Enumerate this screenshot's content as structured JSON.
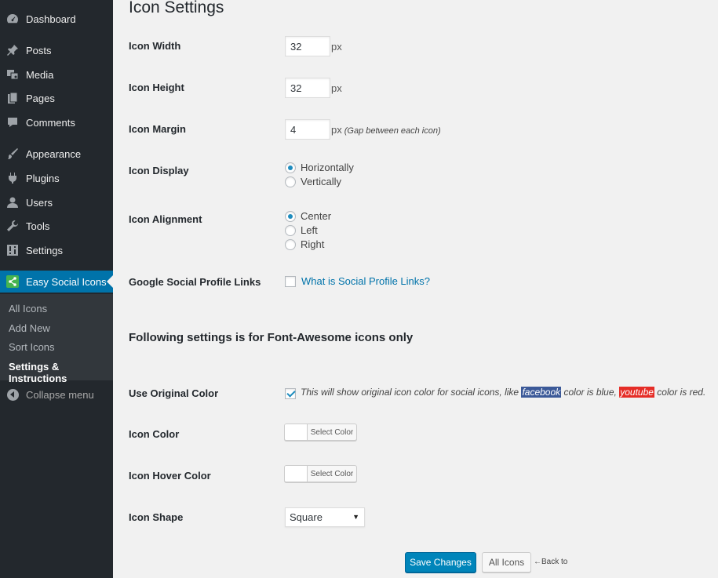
{
  "sidebar": {
    "items": [
      {
        "label": "Dashboard",
        "icon": "dashboard-icon"
      },
      {
        "label": "Posts",
        "icon": "pin-icon"
      },
      {
        "label": "Media",
        "icon": "media-icon"
      },
      {
        "label": "Pages",
        "icon": "pages-icon"
      },
      {
        "label": "Comments",
        "icon": "comment-icon"
      },
      {
        "label": "Appearance",
        "icon": "brush-icon"
      },
      {
        "label": "Plugins",
        "icon": "plug-icon"
      },
      {
        "label": "Users",
        "icon": "user-icon"
      },
      {
        "label": "Tools",
        "icon": "wrench-icon"
      },
      {
        "label": "Settings",
        "icon": "settings-icon"
      },
      {
        "label": "Easy Social Icons",
        "icon": "share-icon",
        "current": true
      }
    ],
    "submenu": [
      "All Icons",
      "Add New",
      "Sort Icons",
      "Settings & Instructions"
    ],
    "submenu_current": "Settings & Instructions",
    "collapse_label": "Collapse menu",
    "colors": {
      "bg": "#23282d",
      "accent": "#0073aa",
      "submenu_bg": "#32373c"
    }
  },
  "main": {
    "title": "Icon Settings",
    "icon_width": {
      "label": "Icon Width",
      "value": "32",
      "unit": "px"
    },
    "icon_height": {
      "label": "Icon Height",
      "value": "32",
      "unit": "px"
    },
    "icon_margin": {
      "label": "Icon Margin",
      "value": "4",
      "unit": "px",
      "hint": "(Gap between each icon)"
    },
    "icon_display": {
      "label": "Icon Display",
      "options": [
        "Horizontally",
        "Vertically"
      ],
      "selected": "Horizontally"
    },
    "icon_alignment": {
      "label": "Icon Alignment",
      "options": [
        "Center",
        "Left",
        "Right"
      ],
      "selected": "Center"
    },
    "google_links": {
      "label": "Google Social Profile Links",
      "checked": false,
      "link_text": "What is Social Profile Links?"
    },
    "fa_heading": "Following settings is for Font-Awesome icons only",
    "use_original_color": {
      "label": "Use Original Color",
      "checked": true,
      "desc_1": "This will show original icon color for social icons, like",
      "facebook": "facebook",
      "desc_2": "color is blue,",
      "youtube": "youtube",
      "desc_3": "color is red.",
      "facebook_color": "#3b5998",
      "youtube_color": "#e52d27"
    },
    "icon_color": {
      "label": "Icon Color",
      "button": "Select Color"
    },
    "icon_hover_color": {
      "label": "Icon Hover Color",
      "button": "Select Color"
    },
    "icon_shape": {
      "label": "Icon Shape",
      "selected": "Square"
    },
    "save_button": "Save Changes",
    "all_icons_button": "All Icons",
    "back_to": "←Back to"
  }
}
